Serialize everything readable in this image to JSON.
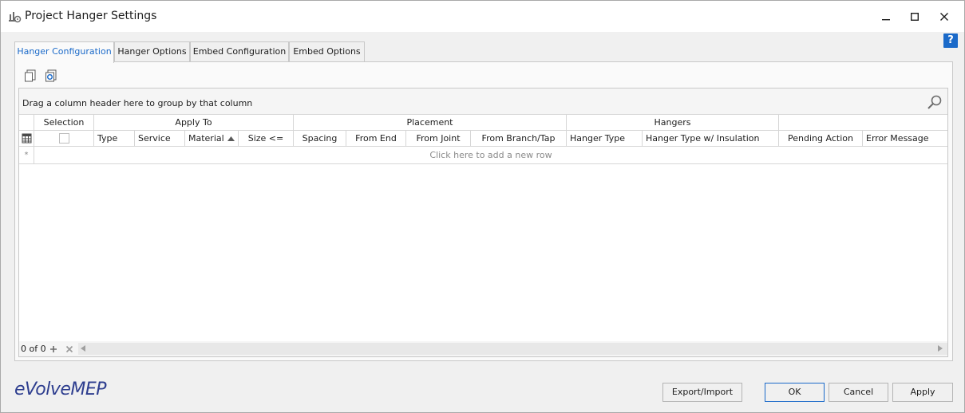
{
  "window": {
    "title": "Project Hanger Settings",
    "app_icon": "hanger-settings-icon",
    "controls": [
      "minimize-icon",
      "maximize-icon",
      "close-icon"
    ]
  },
  "help": {
    "label": "?"
  },
  "tabs": [
    {
      "label": "Hanger Configuration",
      "active": true
    },
    {
      "label": "Hanger Options",
      "active": false
    },
    {
      "label": "Embed Configuration",
      "active": false
    },
    {
      "label": "Embed Options",
      "active": false
    }
  ],
  "toolbar": {
    "icons": [
      "copy-icon",
      "refresh-copy-icon"
    ]
  },
  "grid": {
    "group_panel_text": "Drag a column header here to group by that column",
    "bands": {
      "selection": "Selection",
      "apply_to": "Apply To",
      "placement": "Placement",
      "hangers": "Hangers",
      "extra": ""
    },
    "columns": {
      "type": "Type",
      "service": "Service",
      "material": "Material",
      "size": "Size <=",
      "spacing": "Spacing",
      "from_end": "From End",
      "from_joint": "From Joint",
      "from_branch": "From Branch/Tap",
      "hanger_type": "Hanger Type",
      "hanger_type_insulation": "Hanger Type w/ Insulation",
      "pending_action": "Pending Action",
      "error_message": "Error Message"
    },
    "sorted_column": "Material",
    "sort_direction": "ascending",
    "new_row_marker": "*",
    "new_row_text": "Click here to add a new row",
    "record_count": "0 of 0"
  },
  "brand": {
    "logo_text": "eVolveMEP",
    "color": "#2e3e8f"
  },
  "buttons": {
    "export_import": "Export/Import",
    "ok": "OK",
    "cancel": "Cancel",
    "apply": "Apply"
  },
  "colors": {
    "accent": "#1b6ac9",
    "border": "#c8c8c8"
  }
}
